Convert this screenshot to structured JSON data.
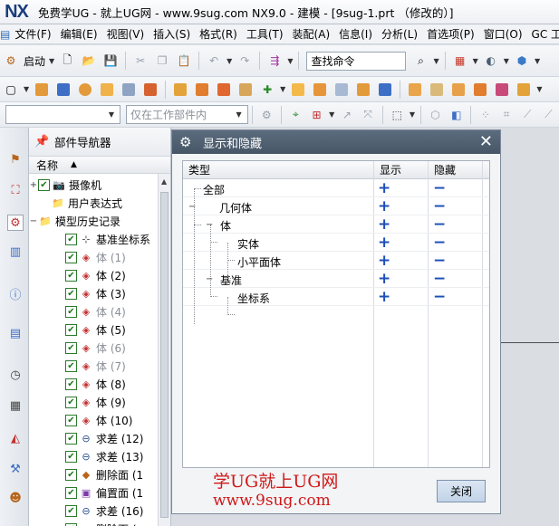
{
  "window": {
    "logo": "NX",
    "title": "免费学UG - 就上UG网 - www.9sug.com NX9.0 - 建模 - [9sug-1.prt （修改的）]"
  },
  "menu": {
    "items": [
      "文件(F)",
      "编辑(E)",
      "视图(V)",
      "插入(S)",
      "格式(R)",
      "工具(T)",
      "装配(A)",
      "信息(I)",
      "分析(L)",
      "首选项(P)",
      "窗口(O)",
      "GC 工具"
    ]
  },
  "toolbar": {
    "start_label": "启动",
    "search_placeholder": "查找命令",
    "filter_placeholder": "仅在工作部件内"
  },
  "navigator": {
    "title": "部件导航器",
    "column_name": "名称",
    "rows": [
      {
        "label": "摄像机",
        "checked": true,
        "greyed": false
      },
      {
        "label": "用户表达式",
        "checked": false,
        "greyed": false
      },
      {
        "label": "模型历史记录",
        "checked": false,
        "greyed": false
      },
      {
        "label": "基准坐标系",
        "checked": true,
        "greyed": false
      },
      {
        "label": "体 (1)",
        "checked": true,
        "greyed": true
      },
      {
        "label": "体 (2)",
        "checked": true,
        "greyed": false
      },
      {
        "label": "体 (3)",
        "checked": true,
        "greyed": false
      },
      {
        "label": "体 (4)",
        "checked": true,
        "greyed": true
      },
      {
        "label": "体 (5)",
        "checked": true,
        "greyed": false
      },
      {
        "label": "体 (6)",
        "checked": true,
        "greyed": true
      },
      {
        "label": "体 (7)",
        "checked": true,
        "greyed": true
      },
      {
        "label": "体 (8)",
        "checked": true,
        "greyed": false
      },
      {
        "label": "体 (9)",
        "checked": true,
        "greyed": false
      },
      {
        "label": "体 (10)",
        "checked": true,
        "greyed": false
      },
      {
        "label": "求差 (12)",
        "checked": true,
        "greyed": false
      },
      {
        "label": "求差 (13)",
        "checked": true,
        "greyed": false
      },
      {
        "label": "删除面 (1",
        "checked": true,
        "greyed": false
      },
      {
        "label": "偏置面 (1",
        "checked": true,
        "greyed": false
      },
      {
        "label": "求差 (16)",
        "checked": true,
        "greyed": false
      },
      {
        "label": "删除面 (",
        "checked": true,
        "greyed": false
      }
    ]
  },
  "dialog": {
    "title": "显示和隐藏",
    "columns": {
      "type": "类型",
      "show": "显示",
      "hide": "隐藏"
    },
    "rows": [
      {
        "label": "全部",
        "show": "+",
        "hide": "−"
      },
      {
        "label": "几何体",
        "show": "+",
        "hide": "−"
      },
      {
        "label": "体",
        "show": "+",
        "hide": "−"
      },
      {
        "label": "实体",
        "show": "+",
        "hide": "−"
      },
      {
        "label": "小平面体",
        "show": "+",
        "hide": "−"
      },
      {
        "label": "基准",
        "show": "+",
        "hide": "−"
      },
      {
        "label": "坐标系",
        "show": "+",
        "hide": "−"
      }
    ],
    "close_label": "关闭"
  },
  "watermark": {
    "line1": "学UG就上UG网",
    "line2": "www.9sug.com"
  },
  "colors": {
    "dialog_header": "#4f6072",
    "accent_plus": "#1c4fb7",
    "watermark": "#d01818"
  }
}
